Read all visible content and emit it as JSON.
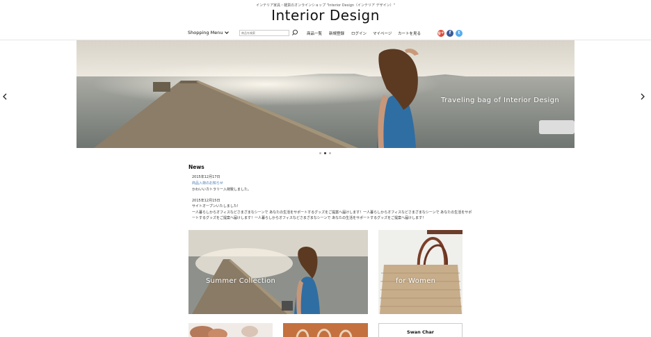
{
  "header": {
    "tagline": "インテリア家具・雑貨のオンラインショップ \"Interior Design（インテリア デザイン）\"",
    "title": "Interior Design"
  },
  "nav": {
    "shopping_menu": "Shopping Menu",
    "search_placeholder": "商品を検索",
    "links": [
      "商品一覧",
      "新規登録",
      "ログイン",
      "マイページ",
      "カートを見る"
    ],
    "social": [
      {
        "name": "google-plus-icon",
        "glyph": "g+",
        "color": "#dd4b39"
      },
      {
        "name": "facebook-icon",
        "glyph": "f",
        "color": "#3b5998"
      },
      {
        "name": "twitter-icon",
        "glyph": "t",
        "color": "#55acee"
      }
    ]
  },
  "hero": {
    "caption": "Traveling bag of Interior Design",
    "slide_count": 3,
    "active_slide": 2
  },
  "news": {
    "heading": "News",
    "items": [
      {
        "date": "2015年12月17日",
        "title": "商品入荷のお知らせ",
        "body": [
          "かわいいカトラリー入荷致しました。"
        ]
      },
      {
        "date": "2015年12月15日",
        "title": "サイトオープンいたしました!",
        "body": [
          "一人暮らしからオフィスなどさまざまなシーンで あなたの生活をサポートするグッズをご提案へ届けします！一人暮らしからオフィスなどさまざまなシーンで あなたの生活をサポ",
          "ートするグッズをご提案へ届けします！一人暮らしからオフィスなどさまざまなシーンで あなたの生活をサポートするグッズをご提案へ届けします！"
        ]
      }
    ]
  },
  "collections": {
    "summer": "Summer Collection",
    "women": "for Women",
    "swan": "Swan Char"
  }
}
